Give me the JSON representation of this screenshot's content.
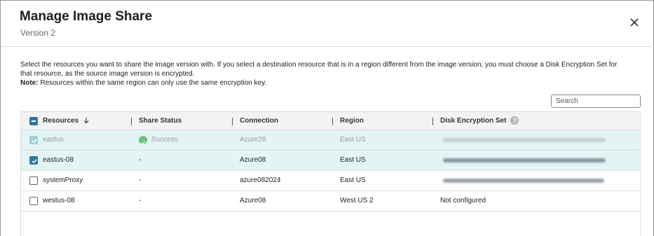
{
  "dialog": {
    "title": "Manage Image Share",
    "subtitle": "Version 2"
  },
  "intro": {
    "text": "Select the resources you want to share the image version with. If you select a destination resource that is in a region different from the image version, you must choose a Disk Encryption Set for that resource, as the source image version is encrypted.",
    "note_label": "Note:",
    "note_text": " Resources within the same region can only use the same encryption key."
  },
  "search": {
    "placeholder": "Search"
  },
  "table": {
    "columns": {
      "resources": "Resources",
      "share_status": "Share Status",
      "connection": "Connection",
      "region": "Region",
      "disk_encryption_set": "Disk Encryption Set"
    },
    "rows": [
      {
        "resource": "eastus",
        "status": "Success",
        "connection": "Azure28",
        "region": "East US",
        "disk_encryption_set": "",
        "checked": true,
        "disabled": true
      },
      {
        "resource": "eastus-08",
        "status": "-",
        "connection": "Azure08",
        "region": "East US",
        "disk_encryption_set": "",
        "checked": true,
        "disabled": false
      },
      {
        "resource": "systemProxy",
        "status": "-",
        "connection": "azure082024",
        "region": "East US",
        "disk_encryption_set": "",
        "checked": false,
        "disabled": false
      },
      {
        "resource": "westus-08",
        "status": "-",
        "connection": "Azure08",
        "region": "West US 2",
        "disk_encryption_set": "Not configured",
        "checked": false,
        "disabled": false
      }
    ]
  },
  "colors": {
    "accent": "#2c7a9a",
    "selected_row": "#e3f4f5",
    "success": "#6fbf7a"
  }
}
